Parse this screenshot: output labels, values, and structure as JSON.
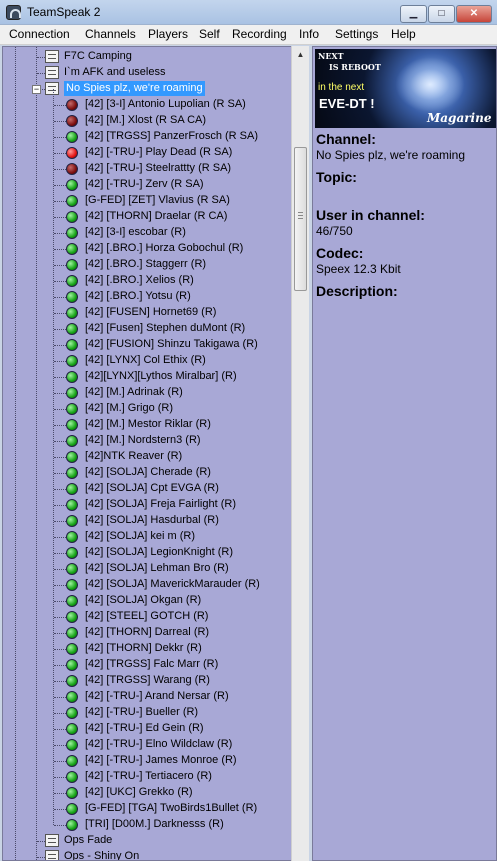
{
  "window": {
    "title": "TeamSpeak 2",
    "minimize_glyph": "▁",
    "maximize_glyph": "□",
    "close_glyph": "✕"
  },
  "menu": [
    "Connection",
    "Channels",
    "Players",
    "Self",
    "Recording",
    "Info",
    "Settings",
    "Help"
  ],
  "tree": {
    "channels_top": [
      "F7C Camping",
      "I`m AFK and useless"
    ],
    "selected_channel": "No Spies plz, we're roaming",
    "expander_glyph": "−",
    "players": [
      {
        "name": "[42] [3-I] Antonio Lupolian",
        "flags": "(R SA)",
        "status": "darkred"
      },
      {
        "name": "[42] [M.] Xlost",
        "flags": "(R SA CA)",
        "status": "darkred"
      },
      {
        "name": "[42] [TRGSS] PanzerFrosch",
        "flags": "(R SA)",
        "status": "green"
      },
      {
        "name": "[42] [-TRU-] Play Dead",
        "flags": "(R SA)",
        "status": "red"
      },
      {
        "name": "[42] [-TRU-] Steelrattty",
        "flags": "(R SA)",
        "status": "darkred"
      },
      {
        "name": "[42] [-TRU-] Zerv",
        "flags": "(R SA)",
        "status": "green"
      },
      {
        "name": "[G-FED] [ZET] Vlavius",
        "flags": "(R SA)",
        "status": "green"
      },
      {
        "name": "[42] [THORN] Draelar",
        "flags": "(R CA)",
        "status": "green"
      },
      {
        "name": "[42] [3-I] escobar",
        "flags": "(R)",
        "status": "green"
      },
      {
        "name": "[42] [.BRO.] Horza Gobochul",
        "flags": "(R)",
        "status": "green"
      },
      {
        "name": "[42] [.BRO.] Staggerr",
        "flags": "(R)",
        "status": "green"
      },
      {
        "name": "[42] [.BRO.] Xelios",
        "flags": "(R)",
        "status": "green"
      },
      {
        "name": "[42] [.BRO.] Yotsu",
        "flags": "(R)",
        "status": "green"
      },
      {
        "name": "[42] [FUSEN] Hornet69",
        "flags": "(R)",
        "status": "green"
      },
      {
        "name": "[42] [Fusen] Stephen duMont",
        "flags": "(R)",
        "status": "green"
      },
      {
        "name": "[42] [FUSION] Shinzu Takigawa",
        "flags": "(R)",
        "status": "green"
      },
      {
        "name": "[42] [LYNX] Col Ethix",
        "flags": "(R)",
        "status": "green"
      },
      {
        "name": "[42][LYNX][Lythos Miralbar]",
        "flags": "(R)",
        "status": "green"
      },
      {
        "name": "[42] [M.] Adrinak",
        "flags": "(R)",
        "status": "green"
      },
      {
        "name": "[42] [M.] Grigo",
        "flags": "(R)",
        "status": "green"
      },
      {
        "name": "[42] [M.] Mestor Riklar",
        "flags": "(R)",
        "status": "green"
      },
      {
        "name": "[42] [M.] Nordstern3",
        "flags": "(R)",
        "status": "green"
      },
      {
        "name": "[42]NTK Reaver",
        "flags": "(R)",
        "status": "green"
      },
      {
        "name": "[42] [SOLJA] Cherade",
        "flags": "(R)",
        "status": "green"
      },
      {
        "name": "[42] [SOLJA] Cpt EVGA",
        "flags": "(R)",
        "status": "green"
      },
      {
        "name": "[42] [SOLJA] Freja Fairlight",
        "flags": "(R)",
        "status": "green"
      },
      {
        "name": "[42] [SOLJA] Hasdurbal",
        "flags": "(R)",
        "status": "green"
      },
      {
        "name": "[42] [SOLJA] kei m",
        "flags": "(R)",
        "status": "green"
      },
      {
        "name": "[42] [SOLJA] LegionKnight",
        "flags": "(R)",
        "status": "green"
      },
      {
        "name": "[42] [SOLJA] Lehman Bro",
        "flags": "(R)",
        "status": "green"
      },
      {
        "name": "[42] [SOLJA] MaverickMarauder",
        "flags": "(R)",
        "status": "green"
      },
      {
        "name": "[42] [SOLJA] Okgan",
        "flags": "(R)",
        "status": "green"
      },
      {
        "name": "[42] [STEEL] GOTCH",
        "flags": "(R)",
        "status": "green"
      },
      {
        "name": "[42] [THORN] Darreal",
        "flags": "(R)",
        "status": "green"
      },
      {
        "name": "[42] [THORN] Dekkr",
        "flags": "(R)",
        "status": "green"
      },
      {
        "name": "[42] [TRGSS] Falc Marr",
        "flags": "(R)",
        "status": "green"
      },
      {
        "name": "[42] [TRGSS] Warang",
        "flags": "(R)",
        "status": "green"
      },
      {
        "name": "[42] [-TRU-] Arand Nersar",
        "flags": "(R)",
        "status": "green"
      },
      {
        "name": "[42] [-TRU-] Bueller",
        "flags": "(R)",
        "status": "green"
      },
      {
        "name": "[42] [-TRU-] Ed Gein",
        "flags": "(R)",
        "status": "green"
      },
      {
        "name": "[42] [-TRU-] Elno Wildclaw",
        "flags": "(R)",
        "status": "green"
      },
      {
        "name": "[42] [-TRU-] James Monroe",
        "flags": "(R)",
        "status": "green"
      },
      {
        "name": "[42] [-TRU-] Tertiacero",
        "flags": "(R)",
        "status": "green"
      },
      {
        "name": "[42] [UKC] Grekko",
        "flags": "(R)",
        "status": "green"
      },
      {
        "name": "[G-FED] [TGA] TwoBirds1Bullet",
        "flags": "(R)",
        "status": "green"
      },
      {
        "name": "[TRI] [D00M.] Darknesss",
        "flags": "(R)",
        "status": "green"
      }
    ],
    "channels_bottom": [
      "Ops Fade",
      "Ops - Shiny On"
    ]
  },
  "scrollbar": {
    "up_glyph": "▲"
  },
  "banner": {
    "line1": "NEXT",
    "line2": "IS REBOOT",
    "line3": "in the next",
    "line4": "EVE-DT !",
    "line5": "Magarine"
  },
  "info": {
    "channel_label": "Channel:",
    "channel_value": "No Spies plz, we're roaming",
    "topic_label": "Topic:",
    "users_label": "User in channel:",
    "users_value": "46/750",
    "codec_label": "Codec:",
    "codec_value": "Speex 12.3 Kbit",
    "description_label": "Description:"
  },
  "colors": {
    "panel_bg": "#a8a8d6",
    "selection": "#3399ff",
    "status_green": "#17a317",
    "status_red": "#e31414",
    "status_darkred": "#7d1010"
  }
}
